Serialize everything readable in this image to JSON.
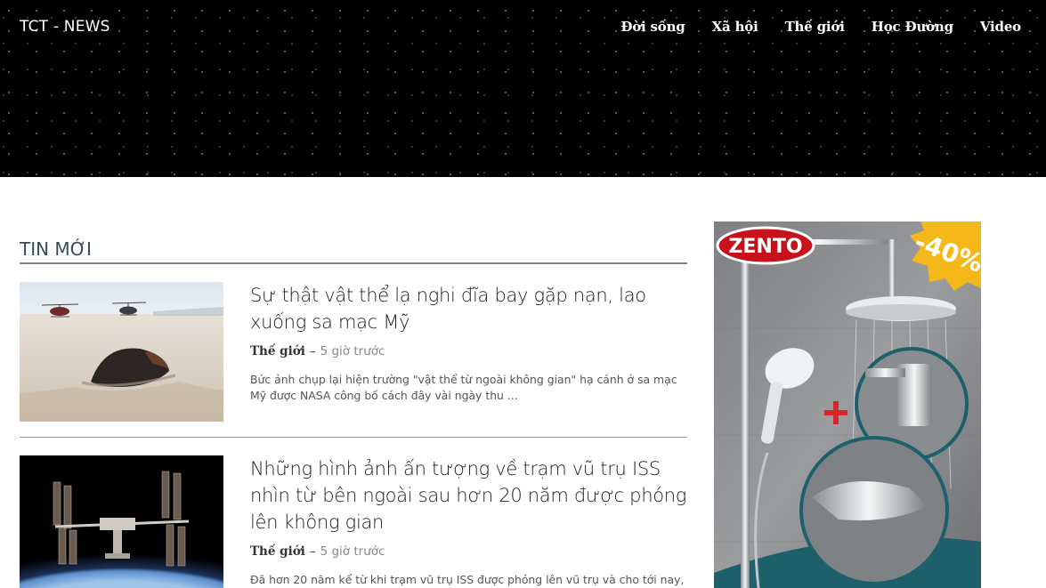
{
  "site": {
    "logo": "TCT - NEWS"
  },
  "nav": {
    "items": [
      {
        "label": "Đời sống"
      },
      {
        "label": "Xã hội"
      },
      {
        "label": "Thế giới"
      },
      {
        "label": "Học Đường"
      },
      {
        "label": "Video"
      }
    ]
  },
  "section": {
    "title": "TIN MỚI"
  },
  "articles": [
    {
      "title": "Sự thật vật thể lạ nghi đĩa bay gặp nạn, lao xuống sa mạc Mỹ",
      "category": "Thế giới",
      "separator": "–",
      "time": "5 giờ trước",
      "description": "Bức ảnh chụp lại hiện trường \"vật thể từ ngoài không gian\" hạ cánh ở sa mạc Mỹ được NASA công bố cách đây vài ngày thu ..."
    },
    {
      "title": "Những hình ảnh ấn tượng về trạm vũ trụ ISS nhìn từ bên ngoài sau hơn 20 năm được phóng lên không gian",
      "category": "Thế giới",
      "separator": "–",
      "time": "5 giờ trước",
      "description": "Đã hơn 20 năm kể từ khi trạm vũ trụ ISS được phóng lên vũ trụ và cho tới nay,"
    }
  ],
  "ad": {
    "brand": "ZENTO",
    "discount": "-40%"
  }
}
